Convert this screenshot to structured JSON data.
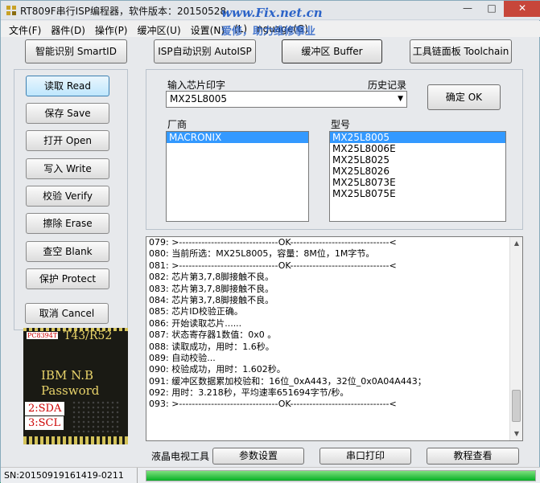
{
  "window": {
    "title": "RT809F串行ISP编程器，软件版本：20150528",
    "watermark": "www.Fix.net.cn",
    "watermark_sub": "爱修，助力维修事业"
  },
  "menu": [
    "文件(F)",
    "器件(D)",
    "操作(P)",
    "缓冲区(U)",
    "设置(N)",
    "(L)",
    "nguage(G)"
  ],
  "topbar": {
    "smartid": "智能识别 SmartID",
    "autoisp": "ISP自动识别 AutoISP",
    "buffer": "缓冲区 Buffer",
    "toolchain": "工具链面板 Toolchain"
  },
  "side": {
    "buttons": [
      {
        "label": "读取 Read"
      },
      {
        "label": "保存 Save"
      },
      {
        "label": "打开 Open"
      },
      {
        "label": "写入 Write"
      },
      {
        "label": "校验 Verify"
      },
      {
        "label": "擦除 Erase"
      },
      {
        "label": "查空 Blank"
      },
      {
        "label": "保护 Protect"
      }
    ],
    "cancel": "取消 Cancel"
  },
  "chip": {
    "tag": "PC8394T",
    "code": "T43/R52",
    "line1": "IBM N.B",
    "line2": "Password",
    "pin2": "2:SDA",
    "pin3": "3:SCL"
  },
  "chipsel": {
    "label": "输入芯片印字",
    "history": "历史记录",
    "value": "MX25L8005",
    "ok": "确定 OK",
    "vendor_label": "厂商",
    "model_label": "型号",
    "vendors": [
      "MACRONIX"
    ],
    "models": [
      "MX25L8005",
      "MX25L8006E",
      "MX25L8025",
      "MX25L8026",
      "MX25L8073E",
      "MX25L8075E"
    ]
  },
  "log": [
    "079: >-------------------------------OK-------------------------------<",
    "080: 当前所选：MX25L8005，容量：8M位，1M字节。",
    "081: >-------------------------------OK-------------------------------<",
    "082: 芯片第3,7,8脚接触不良。",
    "083: 芯片第3,7,8脚接触不良。",
    "084: 芯片第3,7,8脚接触不良。",
    "085: 芯片ID校验正确。",
    "086: 开始读取芯片......",
    "087: 状态寄存器1数值：0x0 。",
    "088: 读取成功，用时：1.6秒。",
    "089: 自动校验...",
    "090: 校验成功，用时：1.602秒。",
    "091: 缓冲区数据累加校验和：16位_0xA443，32位_0x0A04A443；",
    "092: 用时：3.218秒，平均速率651694字节/秒。",
    "093: >-------------------------------OK-------------------------------<"
  ],
  "bottom": {
    "lcd_tool": "液晶电视工具",
    "params": "参数设置",
    "serial": "串口打印",
    "tutorial": "教程查看"
  },
  "status": {
    "sn": "SN:20150919161419-0211",
    "progress": 1.0
  }
}
